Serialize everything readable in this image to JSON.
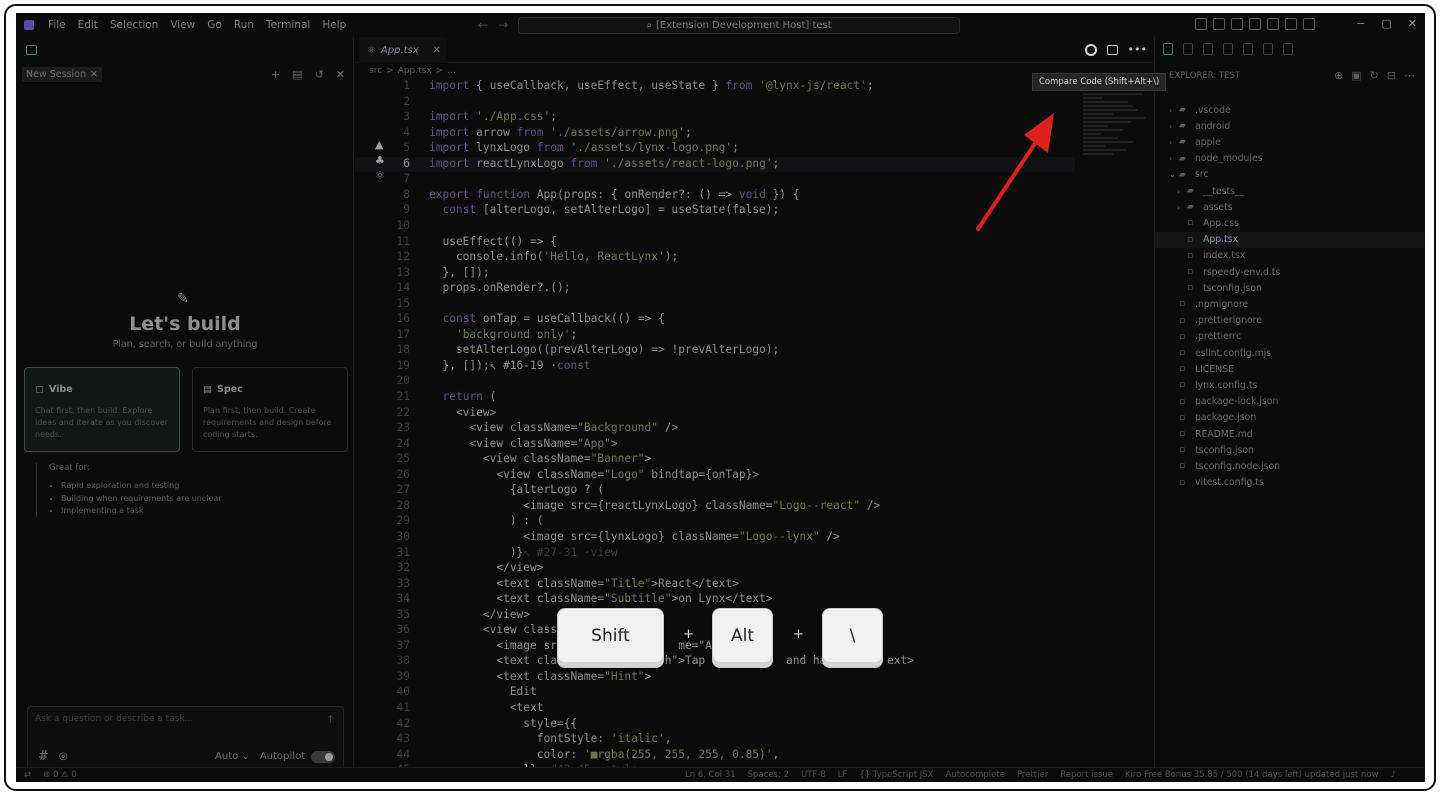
{
  "titlebar": {
    "menu": [
      "File",
      "Edit",
      "Selection",
      "View",
      "Go",
      "Run",
      "Terminal",
      "Help"
    ],
    "command_center": "[Extension Development Host] test",
    "window_controls": [
      "−",
      "▢",
      "✕"
    ]
  },
  "chat": {
    "session_tab": "New Session",
    "title": "Let's build",
    "subtitle": "Plan, search, or build anything",
    "modes": [
      {
        "title": "Vibe",
        "desc": "Chat first, then build. Explore ideas and iterate as you discover needs."
      },
      {
        "title": "Spec",
        "desc": "Plan first, then build. Create requirements and design before coding starts."
      }
    ],
    "great_for_title": "Great for:",
    "great_for": [
      "Rapid exploration and testing",
      "Building when requirements are unclear",
      "Implementing a task"
    ],
    "input_placeholder": "Ask a question or describe a task...",
    "hash_label": "#",
    "model_label": "Auto",
    "autopilot_label": "Autopilot",
    "autopilot_on": true
  },
  "editor": {
    "tab_label": "App.tsx",
    "breadcrumb": [
      "src",
      ">",
      "App.tsx",
      ">",
      "..."
    ],
    "tooltip": "Compare Code (Shift+Alt+\\)",
    "lines": [
      {
        "n": "1",
        "t": "import { useCallback, useEffect, useState } from '@lynx-js/react';"
      },
      {
        "n": "2",
        "t": ""
      },
      {
        "n": "3",
        "t": "import './App.css';"
      },
      {
        "n": "4",
        "t": "import arrow from './assets/arrow.png';"
      },
      {
        "n": "5",
        "t": "import lynxLogo from './assets/lynx-logo.png';"
      },
      {
        "n": "6",
        "t": "import reactLynxLogo from './assets/react-logo.png';"
      },
      {
        "n": "7",
        "t": ""
      },
      {
        "n": "8",
        "t": "export function App(props: { onRender?: () => void }) {"
      },
      {
        "n": "9",
        "t": "  const [alterLogo, setAlterLogo] = useState(false);"
      },
      {
        "n": "10",
        "t": ""
      },
      {
        "n": "11",
        "t": "  useEffect(() => {"
      },
      {
        "n": "12",
        "t": "    console.info('Hello, ReactLynx');"
      },
      {
        "n": "13",
        "t": "  }, []);"
      },
      {
        "n": "14",
        "t": "  props.onRender?.();"
      },
      {
        "n": "15",
        "t": ""
      },
      {
        "n": "16",
        "t": "  const onTap = useCallback(() => {"
      },
      {
        "n": "17",
        "t": "    'background only';"
      },
      {
        "n": "18",
        "t": "    setAlterLogo((prevAlterLogo) => !prevAlterLogo);"
      },
      {
        "n": "19",
        "t": "  }, []);↖ #16-19 ·const"
      },
      {
        "n": "20",
        "t": ""
      },
      {
        "n": "21",
        "t": "  return ("
      },
      {
        "n": "22",
        "t": "    <view>"
      },
      {
        "n": "23",
        "t": "      <view className=\"Background\" />"
      },
      {
        "n": "24",
        "t": "      <view className=\"App\">"
      },
      {
        "n": "25",
        "t": "        <view className=\"Banner\">"
      },
      {
        "n": "26",
        "t": "          <view className=\"Logo\" bindtap={onTap}>"
      },
      {
        "n": "27",
        "t": "            {alterLogo ? ("
      },
      {
        "n": "28",
        "t": "              <image src={reactLynxLogo} className=\"Logo--react\" />"
      },
      {
        "n": "29",
        "t": "            ) : ("
      },
      {
        "n": "30",
        "t": "              <image src={lynxLogo} className=\"Logo--lynx\" />"
      },
      {
        "n": "31",
        "t": "            )}↖ #27-31 ·view"
      },
      {
        "n": "32",
        "t": "          </view>"
      },
      {
        "n": "33",
        "t": "          <text className=\"Title\">React</text>"
      },
      {
        "n": "34",
        "t": "          <text className=\"Subtitle\">on Lynx</text>"
      },
      {
        "n": "35",
        "t": "        </view>"
      },
      {
        "n": "36",
        "t": "        <view classNa"
      },
      {
        "n": "37",
        "t": "          <image src=                me=\"Arro"
      },
      {
        "n": "38",
        "t": "          <text class              h\">Tap            and hav        ext>"
      },
      {
        "n": "39",
        "t": "          <text className=\"Hint\">"
      },
      {
        "n": "40",
        "t": "            Edit"
      },
      {
        "n": "41",
        "t": "            <text"
      },
      {
        "n": "42",
        "t": "              style={{"
      },
      {
        "n": "43",
        "t": "                fontStyle: 'italic',"
      },
      {
        "n": "44",
        "t": "                color: '■rgba(255, 255, 255, 0.85)',"
      },
      {
        "n": "45",
        "t": "              }}↖ #42-45 ·style"
      }
    ],
    "current_line": "6"
  },
  "keys": {
    "shift": "Shift",
    "alt": "Alt",
    "backslash": "\\",
    "plus": "+"
  },
  "explorer": {
    "title": "EXPLORER: TEST",
    "items": [
      {
        "label": ".vscode",
        "type": "folder",
        "depth": 0,
        "open": false
      },
      {
        "label": "android",
        "type": "folder",
        "depth": 0,
        "open": false
      },
      {
        "label": "apple",
        "type": "folder",
        "depth": 0,
        "open": false
      },
      {
        "label": "node_modules",
        "type": "folder",
        "depth": 0,
        "open": false
      },
      {
        "label": "src",
        "type": "folder",
        "depth": 0,
        "open": true
      },
      {
        "label": "__tests__",
        "type": "folder",
        "depth": 1,
        "open": false
      },
      {
        "label": "assets",
        "type": "folder",
        "depth": 1,
        "open": false
      },
      {
        "label": "App.css",
        "type": "file",
        "depth": 1
      },
      {
        "label": "App.tsx",
        "type": "file",
        "depth": 1,
        "selected": true
      },
      {
        "label": "index.tsx",
        "type": "file",
        "depth": 1
      },
      {
        "label": "rspeedy-env.d.ts",
        "type": "file",
        "depth": 1
      },
      {
        "label": "tsconfig.json",
        "type": "file",
        "depth": 1
      },
      {
        "label": ".npmignore",
        "type": "file",
        "depth": 0
      },
      {
        "label": ".prettierignore",
        "type": "file",
        "depth": 0
      },
      {
        "label": ".prettierrc",
        "type": "file",
        "depth": 0
      },
      {
        "label": "eslint.config.mjs",
        "type": "file",
        "depth": 0
      },
      {
        "label": "LICENSE",
        "type": "file",
        "depth": 0
      },
      {
        "label": "lynx.config.ts",
        "type": "file",
        "depth": 0
      },
      {
        "label": "package-lock.json",
        "type": "file",
        "depth": 0
      },
      {
        "label": "package.json",
        "type": "file",
        "depth": 0
      },
      {
        "label": "README.md",
        "type": "file",
        "depth": 0
      },
      {
        "label": "tsconfig.json",
        "type": "file",
        "depth": 0
      },
      {
        "label": "tsconfig.node.json",
        "type": "file",
        "depth": 0
      },
      {
        "label": "vitest.config.ts",
        "type": "file",
        "depth": 0
      }
    ]
  },
  "statusbar": {
    "problems": "⊗ 0 ⚠ 0",
    "position": "Ln 6, Col 31",
    "spaces": "Spaces: 2",
    "encoding": "UTF-8",
    "eol": "LF",
    "language": "{} TypeScript JSX",
    "autocomplete": "Autocomplete",
    "prettier": "Prettier",
    "report": "Report issue",
    "bonus": "Kiro Free Bonus 35.85 / 500 (14 days left) updated just now"
  },
  "colors": {
    "accent_arrow": "#e0201c",
    "background": "#0b0b0c",
    "selected_file": "#7a9ab5"
  }
}
